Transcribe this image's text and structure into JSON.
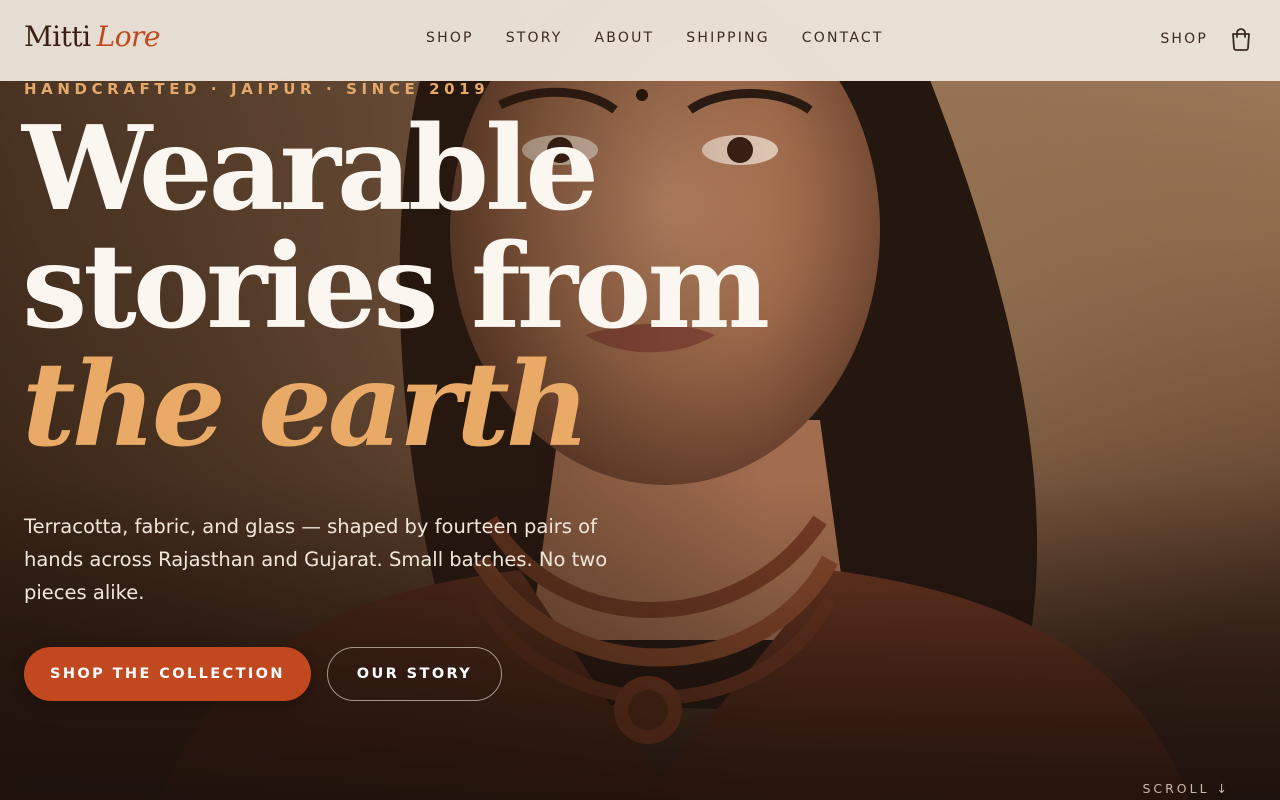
{
  "brand": {
    "name_part1": "Mitti",
    "name_part2": "Lore"
  },
  "nav": {
    "items": [
      {
        "label": "SHOP"
      },
      {
        "label": "STORY"
      },
      {
        "label": "ABOUT"
      },
      {
        "label": "SHIPPING"
      },
      {
        "label": "CONTACT"
      }
    ],
    "right_label": "SHOP",
    "cart_icon": "shopping-bag-icon"
  },
  "hero": {
    "eyebrow": "HANDCRAFTED · JAIPUR · SINCE 2019",
    "headline_line1": "Wearable",
    "headline_line2": "stories from",
    "headline_line3": "the earth",
    "lede": "Terracotta, fabric, and glass — shaped by fourteen pairs of hands across Rajasthan and Gujarat. Small batches. No two pieces alike.",
    "primary_cta": "SHOP THE COLLECTION",
    "secondary_cta": "OUR STORY",
    "scroll_label": "SCROLL ↓"
  },
  "colors": {
    "accent": "#c2481f",
    "headline_accent": "#e8aa66",
    "header_bg": "#ece4da",
    "text_dark": "#3a2a20"
  }
}
